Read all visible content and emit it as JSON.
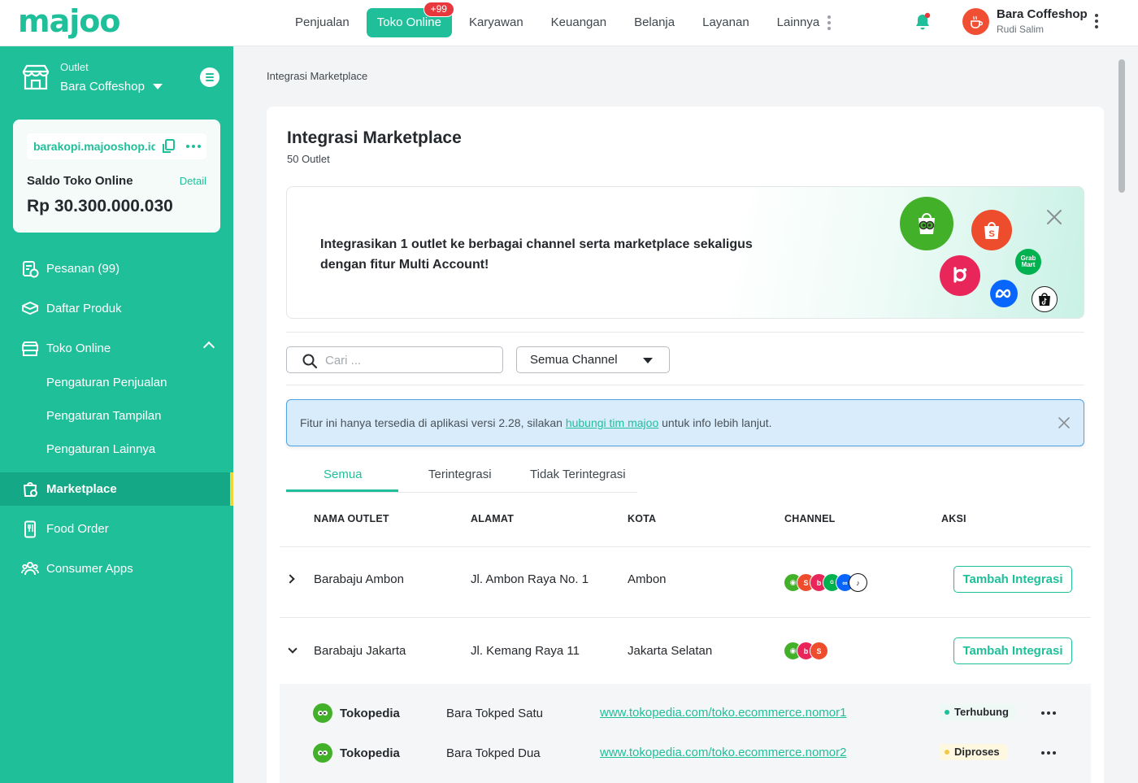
{
  "brand": {
    "logo_text": "majoo",
    "accent": "#1fbf9a"
  },
  "topnav": {
    "items": [
      "Penjualan",
      "Toko Online",
      "Karyawan",
      "Keuangan",
      "Belanja",
      "Layanan",
      "Lainnya"
    ],
    "active": "Toko Online",
    "badge": "+99"
  },
  "user": {
    "name": "Bara Coffeshop",
    "subtitle": "Rudi Salim"
  },
  "sidebar": {
    "outlet_label": "Outlet",
    "outlet_name": "Bara Coffeshop",
    "shop_url": "barakopi.majooshop.id",
    "saldo_label": "Saldo Toko Online",
    "saldo_detail": "Detail",
    "saldo_amount": "Rp 30.300.000.030",
    "menu": [
      {
        "label": "Pesanan (99)",
        "icon": "order-icon"
      },
      {
        "label": "Daftar Produk",
        "icon": "box-icon"
      },
      {
        "label": "Toko Online",
        "icon": "store-www-icon"
      },
      {
        "label": "Marketplace",
        "icon": "marketplace-icon"
      },
      {
        "label": "Food Order",
        "icon": "food-order-icon"
      },
      {
        "label": "Consumer Apps",
        "icon": "consumer-apps-icon"
      }
    ],
    "submenu": [
      "Pengaturan Penjualan",
      "Pengaturan Tampilan",
      "Pengaturan Lainnya"
    ]
  },
  "breadcrumb": "Integrasi Marketplace",
  "page": {
    "title": "Integrasi Marketplace",
    "subtitle": "50 Outlet",
    "banner_text": "Integrasikan 1 outlet ke berbagai channel serta marketplace sekaligus dengan fitur Multi Account!",
    "banner_grab_label": "Grab Mart"
  },
  "filters": {
    "search_placeholder": "Cari ...",
    "channel_select": "Semua Channel"
  },
  "alert": {
    "prefix": "Fitur ini hanya tersedia di aplikasi versi 2.28, silakan ",
    "link": "hubungi tim majoo",
    "suffix": " untuk info lebih lanjut."
  },
  "tabs": [
    "Semua",
    "Terintegrasi",
    "Tidak Terintegrasi"
  ],
  "table": {
    "headers": [
      "NAMA OUTLET",
      "ALAMAT",
      "KOTA",
      "CHANNEL",
      "AKSI"
    ],
    "rows": [
      {
        "name": "Barabaju Ambon",
        "address": "Jl. Ambon Raya No. 1",
        "city": "Ambon",
        "action": "Tambah Integrasi",
        "expanded": false
      },
      {
        "name": "Barabaju Jakarta",
        "address": "Jl. Kemang Raya 11",
        "city": "Jakarta Selatan",
        "action": "Tambah Integrasi",
        "expanded": true
      }
    ],
    "subrows": [
      {
        "channel": "Tokopedia",
        "account": "Bara Tokped Satu",
        "url": "www.tokopedia.com/toko.ecommerce.nomor1",
        "status": "Terhubung"
      },
      {
        "channel": "Tokopedia",
        "account": "Bara Tokped Dua",
        "url": "www.tokopedia.com/toko.ecommerce.nomor2",
        "status": "Diproses"
      }
    ]
  },
  "colors": {
    "tokopedia": "#43b02a",
    "shopee": "#ee4d2d",
    "blibli": "#e8265a",
    "grabmart": "#00b14f",
    "meta": "#0866ff",
    "tiktok": "#111111",
    "alert_bg": "#d8ecfb",
    "status_connected": "#1fbf9a",
    "status_processing": "#f2c84a"
  }
}
